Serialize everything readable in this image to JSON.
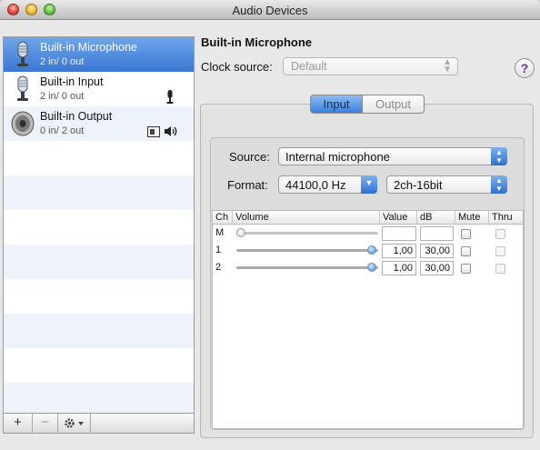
{
  "window": {
    "title": "Audio Devices"
  },
  "devices": [
    {
      "name": "Built-in Microphone",
      "io": "2 in/ 0 out",
      "selected": true,
      "icon": "microphone-icon"
    },
    {
      "name": "Built-in Input",
      "io": "2 in/ 0 out",
      "selected": false,
      "icon": "microphone-icon",
      "badge": "default-input-mic-icon"
    },
    {
      "name": "Built-in Output",
      "io": "0 in/ 2 out",
      "selected": false,
      "icon": "speaker-icon",
      "badge": "default-output-speaker-icon"
    }
  ],
  "list_footer": {
    "add": "+",
    "remove": "−",
    "actions": "gear-icon"
  },
  "detail": {
    "device_title": "Built-in Microphone",
    "clock_label": "Clock source:",
    "clock_value": "Default",
    "help": "?",
    "tabs": {
      "input": "Input",
      "output": "Output",
      "active": "input"
    },
    "source_label": "Source:",
    "source_value": "Internal microphone",
    "format_label": "Format:",
    "format_rate": "44100,0 Hz",
    "format_bits": "2ch-16bit"
  },
  "table": {
    "headers": {
      "ch": "Ch",
      "volume": "Volume",
      "value": "Value",
      "db": "dB",
      "mute": "Mute",
      "thru": "Thru"
    },
    "rows": [
      {
        "ch": "M",
        "value": "",
        "db": "",
        "level": 0.0,
        "mute": false,
        "thru": false
      },
      {
        "ch": "1",
        "value": "1,00",
        "db": "30,00",
        "level": 1.0,
        "mute": false,
        "thru": false
      },
      {
        "ch": "2",
        "value": "1,00",
        "db": "30,00",
        "level": 1.0,
        "mute": false,
        "thru": false
      }
    ]
  },
  "colors": {
    "selection": "#3a77d3",
    "accent": "#2e6ed0"
  }
}
